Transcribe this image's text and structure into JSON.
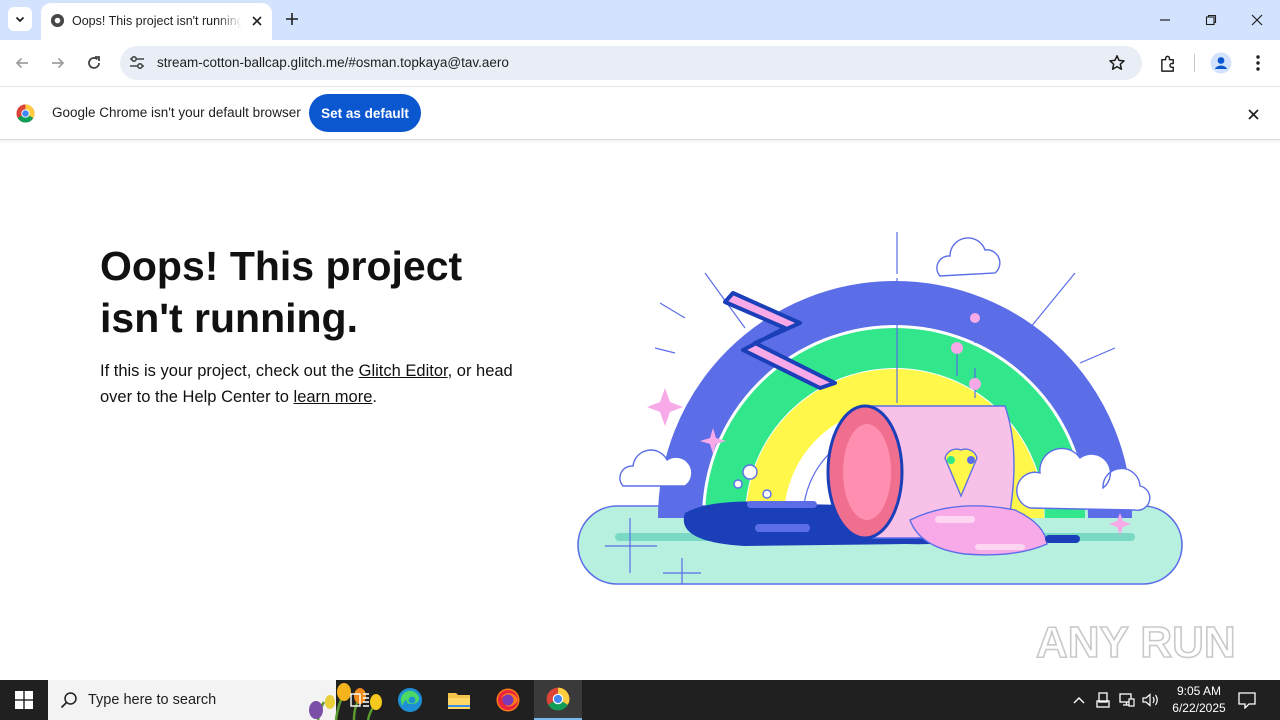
{
  "browser": {
    "tab_title": "Oops! This project isn't running",
    "url": "stream-cotton-ballcap.glitch.me/#osman.topkaya@tav.aero"
  },
  "infobar": {
    "message": "Google Chrome isn't your default browser",
    "button_label": "Set as default"
  },
  "page": {
    "heading": "Oops! This project isn't running.",
    "body_prefix": "If this is your project, check out the ",
    "glitch_editor_link": "Glitch Editor",
    "body_middle": ", or head over to the Help Center to ",
    "learn_more_link": "learn more",
    "body_suffix": "."
  },
  "watermark": {
    "text": "ANY RUN"
  },
  "taskbar": {
    "search_placeholder": "Type here to search",
    "time": "9:05 AM",
    "date": "6/22/2025"
  },
  "colors": {
    "tabstrip": "#d3e3fd",
    "omnibox": "#e9eef6",
    "primary_button": "#0b57d0",
    "taskbar": "#202020"
  }
}
